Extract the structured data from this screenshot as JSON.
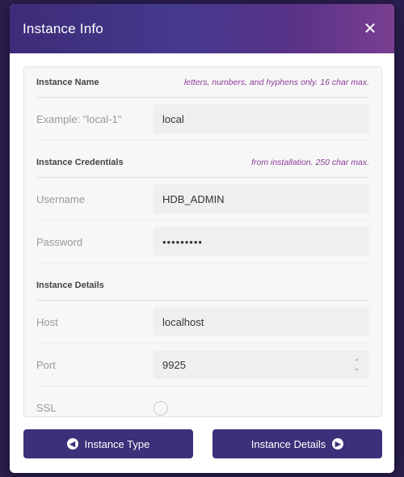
{
  "modal": {
    "title": "Instance Info",
    "close_icon": "close-icon"
  },
  "sections": {
    "name": {
      "title": "Instance Name",
      "hint": "letters, numbers, and hyphens only. 16 char max.",
      "field_label": "Example: \"local-1\"",
      "field_value": "local"
    },
    "credentials": {
      "title": "Instance Credentials",
      "hint": "from installation. 250 char max.",
      "username_label": "Username",
      "username_value": "HDB_ADMIN",
      "password_label": "Password",
      "password_value": "•••••••••"
    },
    "details": {
      "title": "Instance Details",
      "host_label": "Host",
      "host_value": "localhost",
      "port_label": "Port",
      "port_value": "9925",
      "ssl_label": "SSL",
      "ssl_checked": false
    }
  },
  "buttons": {
    "back_label": "Instance Type",
    "back_icon": "chevron-left-circle-icon",
    "next_label": "Instance Details",
    "next_icon": "chevron-right-circle-icon"
  },
  "colors": {
    "header_gradient_start": "#3d2c78",
    "header_gradient_end": "#7a3f90",
    "button_bg": "#3d2f7a",
    "hint_color": "#8a3d96"
  }
}
